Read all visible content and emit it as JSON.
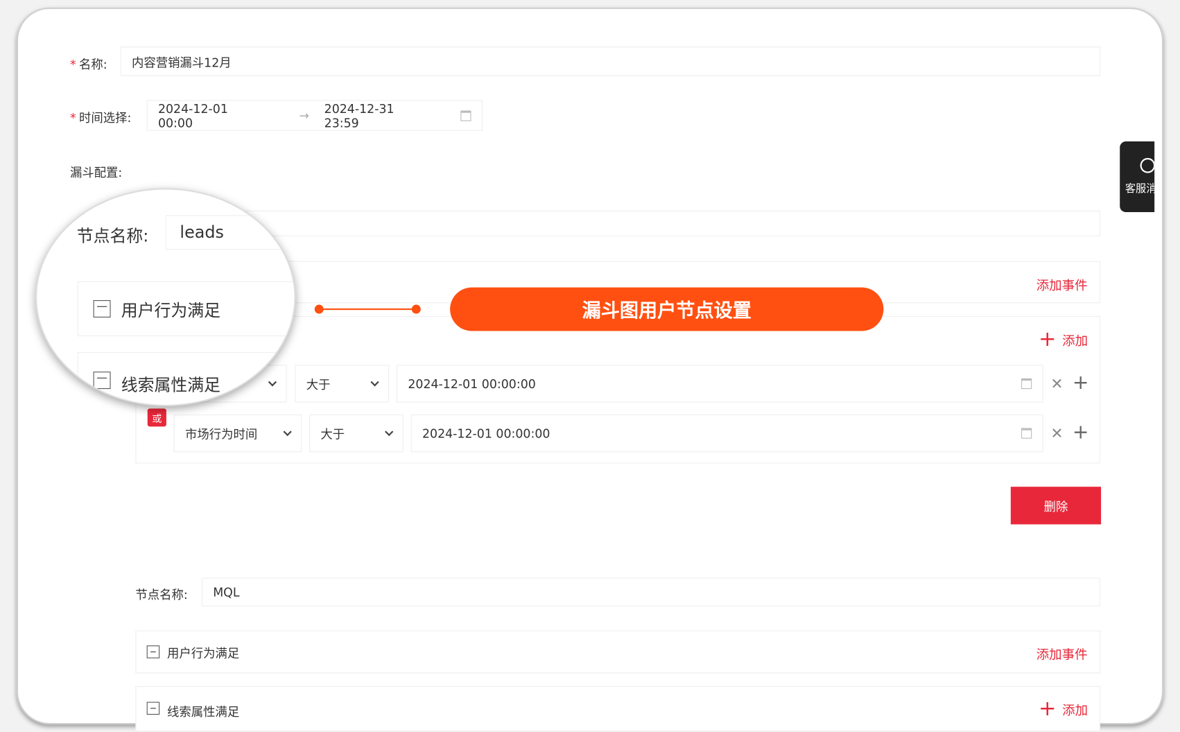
{
  "form": {
    "name_label": "名称:",
    "name_value": "内容营销漏斗12月",
    "time_label": "时间选择:",
    "time_start": "2024-12-01 00:00",
    "time_end": "2024-12-31 23:59",
    "funnel_label": "漏斗配置:"
  },
  "nodes": [
    {
      "name_label": "节点名称:",
      "name_value": "leads",
      "behavior_title": "用户行为满足",
      "add_event": "添加事件",
      "attr_title": "线索属性满足",
      "add": "添加",
      "conditions": [
        {
          "field": "",
          "op": "大于",
          "value": "2024-12-01 00:00:00"
        },
        {
          "field": "市场行为时间",
          "op": "大于",
          "value": "2024-12-01 00:00:00"
        }
      ],
      "or_badge": "或",
      "delete": "删除"
    },
    {
      "name_label": "节点名称:",
      "name_value": "MQL",
      "behavior_title": "用户行为满足",
      "add_event": "添加事件",
      "attr_title": "线索属性满足",
      "add": "添加"
    }
  ],
  "side_tab": {
    "label": "客服消息",
    "icon": "chat-bubble-icon"
  },
  "callout": {
    "text": "漏斗图用户节点设置",
    "color": "#ff5011"
  },
  "colors": {
    "primary_red": "#e8283a",
    "callout_orange": "#ff5011"
  }
}
